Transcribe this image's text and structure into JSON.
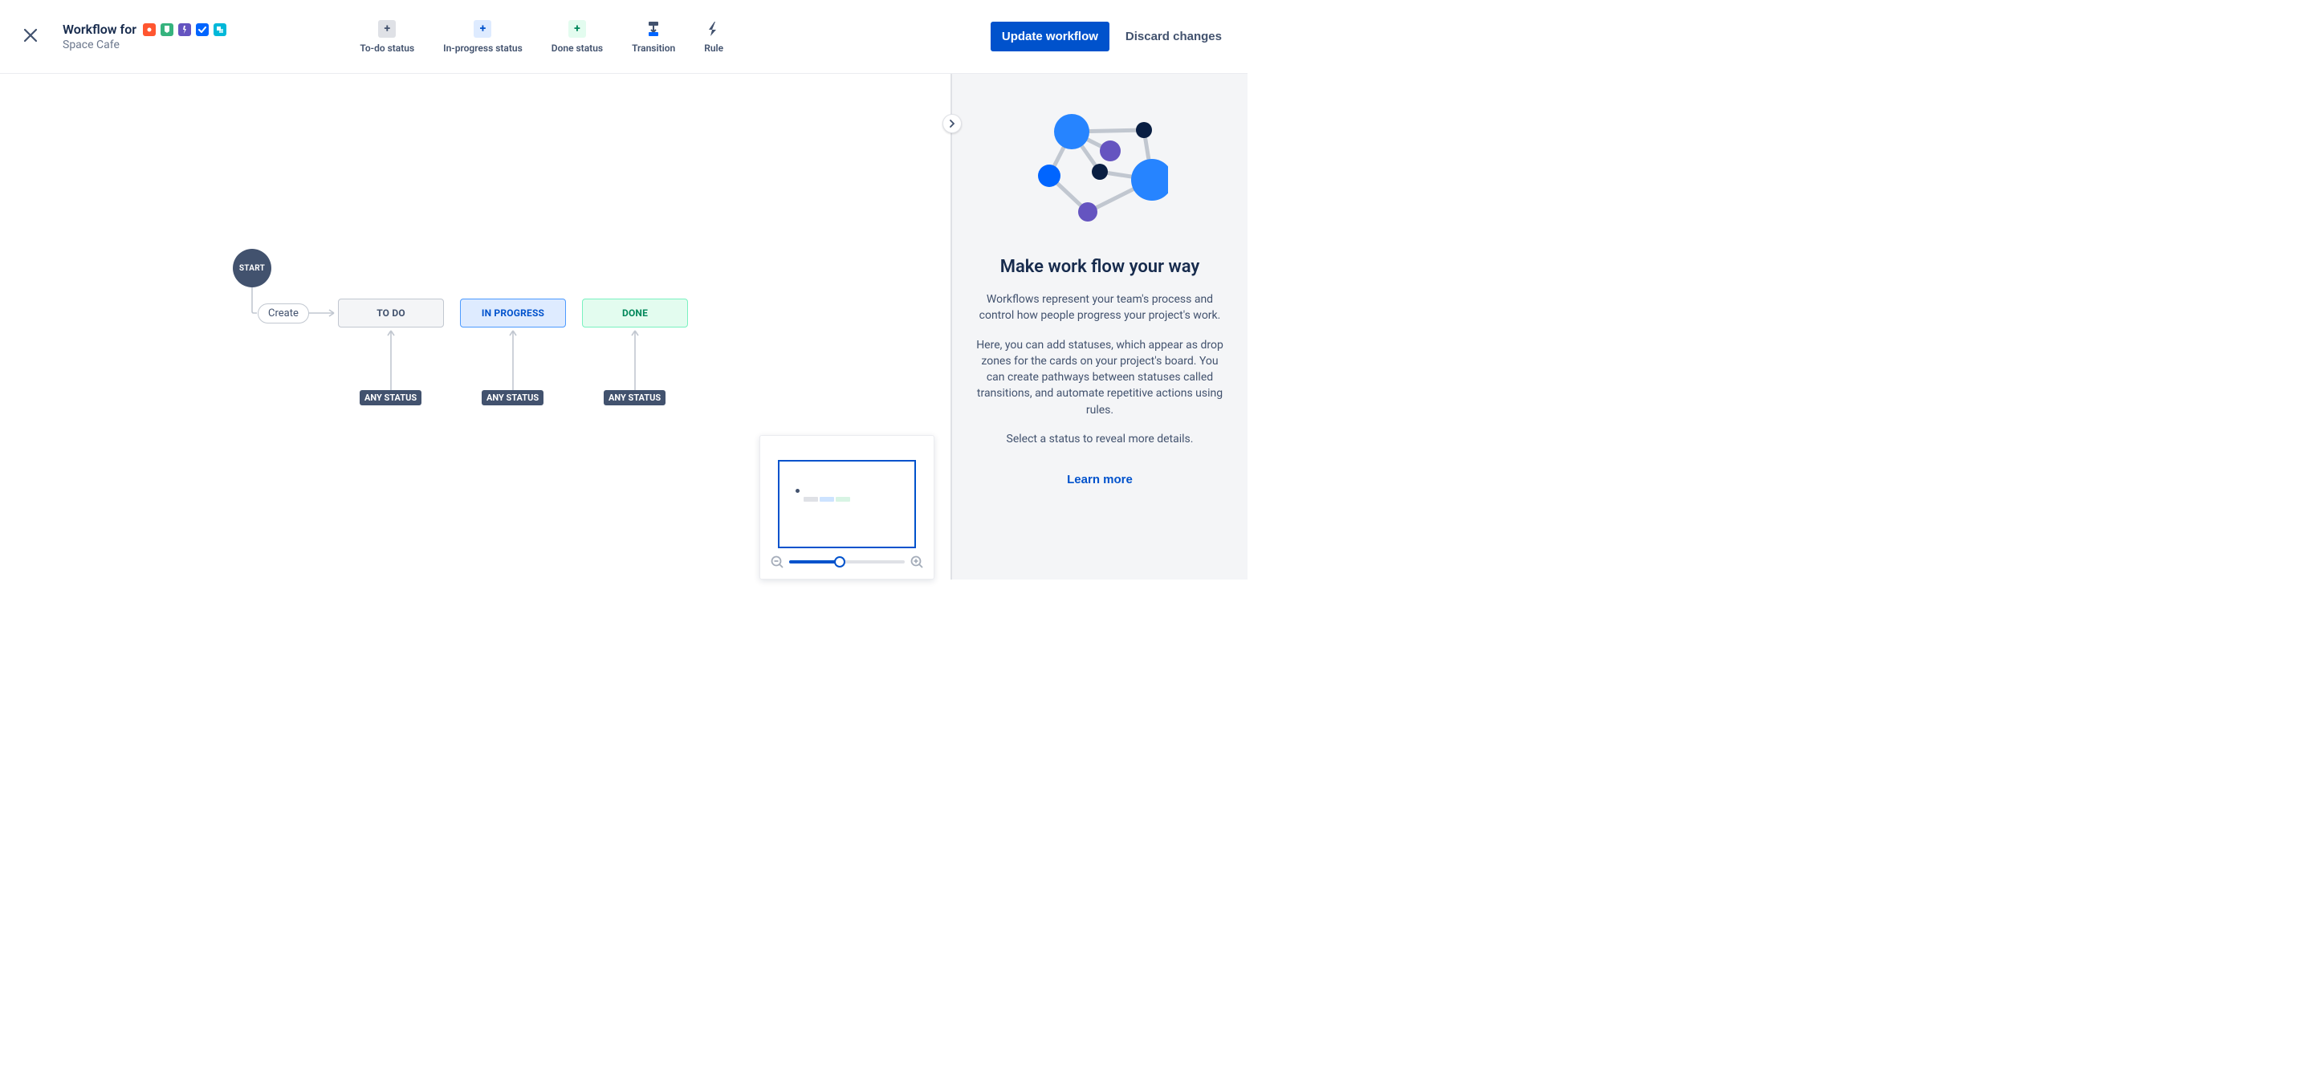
{
  "header": {
    "title_prefix": "Workflow for",
    "subtitle": "Space Cafe",
    "update_label": "Update workflow",
    "discard_label": "Discard changes"
  },
  "toolbar": {
    "todo": "To-do status",
    "inprogress": "In-progress status",
    "done": "Done status",
    "transition": "Transition",
    "rule": "Rule"
  },
  "workflow": {
    "start": "START",
    "create": "Create",
    "todo": "TO DO",
    "inprogress": "IN PROGRESS",
    "done": "DONE",
    "any_status": "ANY STATUS"
  },
  "panel": {
    "title": "Make work flow your way",
    "p1": "Workflows represent your team's process and control how people progress your project's work.",
    "p2": "Here, you can add statuses, which appear as drop zones for the cards on your project's board. You can create pathways between statuses called transitions, and automate repetitive actions using rules.",
    "p3": "Select a status to reveal more details.",
    "learn_more": "Learn more"
  }
}
